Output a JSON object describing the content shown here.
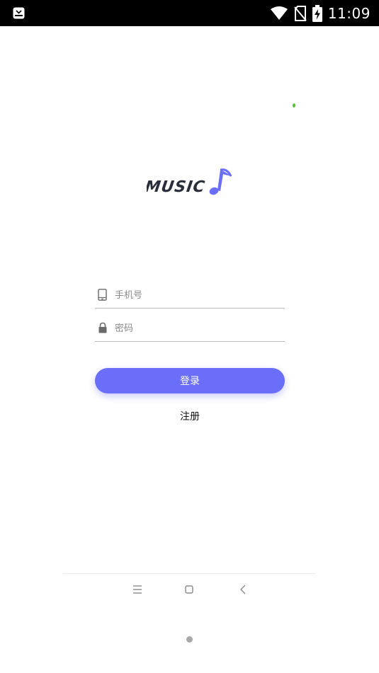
{
  "status_bar": {
    "time": "11:09",
    "left_icon": "notification-app-icon",
    "icons": [
      "wifi-icon",
      "no-sim-icon",
      "battery-charging-icon"
    ]
  },
  "logo": {
    "text": "MUSIC",
    "icon": "music-note-icon",
    "text_color": "#2a2e3a",
    "accent_color": "#6b6ef9"
  },
  "form": {
    "phone": {
      "placeholder": "手机号",
      "value": "",
      "icon": "phone-icon"
    },
    "password": {
      "placeholder": "密码",
      "value": "",
      "icon": "lock-icon"
    },
    "login_label": "登录",
    "register_label": "注册"
  },
  "nav_bar": {
    "buttons": [
      "menu-icon",
      "home-square-icon",
      "back-chevron-icon"
    ]
  },
  "colors": {
    "primary": "#6b6ef9",
    "status_bar_bg": "#000000",
    "divider": "#bdbdbd",
    "indicator_dot": "#55c23a"
  }
}
